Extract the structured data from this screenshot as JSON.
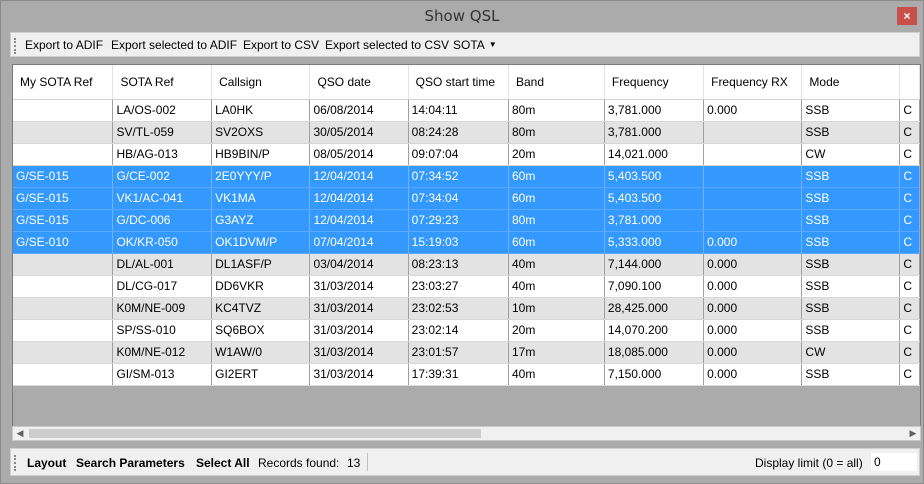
{
  "window": {
    "title": "Show QSL",
    "close_glyph": "×"
  },
  "toolbar": {
    "items": [
      "Export to ADIF",
      "Export selected to ADIF",
      "Export to CSV",
      "Export selected to CSV"
    ],
    "sota_label": "SOTA",
    "sota_caret": "▼"
  },
  "grid": {
    "columns": [
      "My SOTA Ref",
      "SOTA Ref",
      "Callsign",
      "QSO date",
      "QSO start time",
      "Band",
      "Frequency",
      "Frequency RX",
      "Mode"
    ],
    "rows": [
      {
        "my_ref": "",
        "sota_ref": "LA/OS-002",
        "callsign": "LA0HK",
        "date": "06/08/2014",
        "time": "14:04:11",
        "band": "80m",
        "freq": "3,781.000",
        "freq_rx": "0.000",
        "mode": "SSB",
        "extra": "C",
        "selected": false
      },
      {
        "my_ref": "",
        "sota_ref": "SV/TL-059",
        "callsign": "SV2OXS",
        "date": "30/05/2014",
        "time": "08:24:28",
        "band": "80m",
        "freq": "3,781.000",
        "freq_rx": "",
        "mode": "SSB",
        "extra": "C",
        "selected": false
      },
      {
        "my_ref": "",
        "sota_ref": "HB/AG-013",
        "callsign": "HB9BIN/P",
        "date": "08/05/2014",
        "time": "09:07:04",
        "band": "20m",
        "freq": "14,021.000",
        "freq_rx": "",
        "mode": "CW",
        "extra": "C",
        "selected": false
      },
      {
        "my_ref": "G/SE-015",
        "sota_ref": "G/CE-002",
        "callsign": "2E0YYY/P",
        "date": "12/04/2014",
        "time": "07:34:52",
        "band": "60m",
        "freq": "5,403.500",
        "freq_rx": "",
        "mode": "SSB",
        "extra": "C",
        "selected": true
      },
      {
        "my_ref": "G/SE-015",
        "sota_ref": "VK1/AC-041",
        "callsign": "VK1MA",
        "date": "12/04/2014",
        "time": "07:34:04",
        "band": "60m",
        "freq": "5,403.500",
        "freq_rx": "",
        "mode": "SSB",
        "extra": "C",
        "selected": true
      },
      {
        "my_ref": "G/SE-015",
        "sota_ref": "G/DC-006",
        "callsign": "G3AYZ",
        "date": "12/04/2014",
        "time": "07:29:23",
        "band": "80m",
        "freq": "3,781.000",
        "freq_rx": "",
        "mode": "SSB",
        "extra": "C",
        "selected": true
      },
      {
        "my_ref": "G/SE-010",
        "sota_ref": "OK/KR-050",
        "callsign": "OK1DVM/P",
        "date": "07/04/2014",
        "time": "15:19:03",
        "band": "60m",
        "freq": "5,333.000",
        "freq_rx": "0.000",
        "mode": "SSB",
        "extra": "C",
        "selected": true
      },
      {
        "my_ref": "",
        "sota_ref": "DL/AL-001",
        "callsign": "DL1ASF/P",
        "date": "03/04/2014",
        "time": "08:23:13",
        "band": "40m",
        "freq": "7,144.000",
        "freq_rx": "0.000",
        "mode": "SSB",
        "extra": "C",
        "selected": false
      },
      {
        "my_ref": "",
        "sota_ref": "DL/CG-017",
        "callsign": "DD6VKR",
        "date": "31/03/2014",
        "time": "23:03:27",
        "band": "40m",
        "freq": "7,090.100",
        "freq_rx": "0.000",
        "mode": "SSB",
        "extra": "C",
        "selected": false
      },
      {
        "my_ref": "",
        "sota_ref": "K0M/NE-009",
        "callsign": "KC4TVZ",
        "date": "31/03/2014",
        "time": "23:02:53",
        "band": "10m",
        "freq": "28,425.000",
        "freq_rx": "0.000",
        "mode": "SSB",
        "extra": "C",
        "selected": false
      },
      {
        "my_ref": "",
        "sota_ref": "SP/SS-010",
        "callsign": "SQ6BOX",
        "date": "31/03/2014",
        "time": "23:02:14",
        "band": "20m",
        "freq": "14,070.200",
        "freq_rx": "0.000",
        "mode": "SSB",
        "extra": "C",
        "selected": false
      },
      {
        "my_ref": "",
        "sota_ref": "K0M/NE-012",
        "callsign": "W1AW/0",
        "date": "31/03/2014",
        "time": "23:01:57",
        "band": "17m",
        "freq": "18,085.000",
        "freq_rx": "0.000",
        "mode": "CW",
        "extra": "C",
        "selected": false
      },
      {
        "my_ref": "",
        "sota_ref": "GI/SM-013",
        "callsign": "GI2ERT",
        "date": "31/03/2014",
        "time": "17:39:31",
        "band": "40m",
        "freq": "7,150.000",
        "freq_rx": "0.000",
        "mode": "SSB",
        "extra": "C",
        "selected": false
      }
    ]
  },
  "scrollbar": {
    "left_arrow": "◀",
    "right_arrow": "▶"
  },
  "status": {
    "layout_label": "Layout",
    "search_label": "Search Parameters",
    "select_all_label": "Select All",
    "records_label": "Records found:",
    "records_count": "13",
    "display_limit_label": "Display limit (0 = all)",
    "display_limit_value": "0"
  },
  "colors": {
    "selection": "#3399ff",
    "alt_row": "#e3e3e3",
    "close_button": "#c8504a"
  }
}
